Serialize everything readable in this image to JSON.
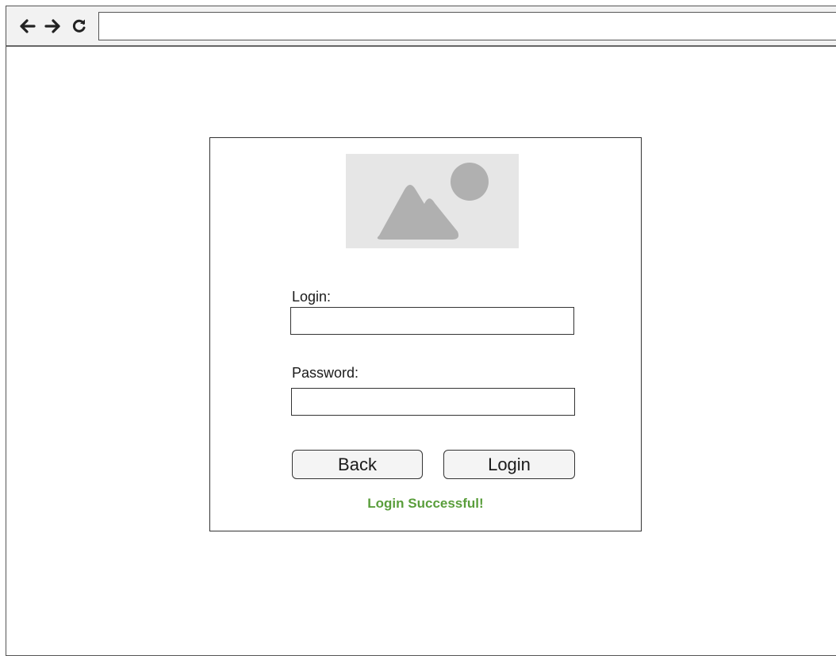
{
  "browser": {
    "back_icon": "arrow-left-icon",
    "forward_icon": "arrow-right-icon",
    "reload_icon": "reload-icon",
    "address_value": ""
  },
  "login_form": {
    "image_icon": "image-placeholder-icon",
    "login_label": "Login:",
    "login_value": "",
    "password_label": "Password:",
    "password_value": "",
    "back_button_label": "Back",
    "login_button_label": "Login",
    "status_message": "Login Successful!",
    "status_color": "#5a9e3c"
  }
}
